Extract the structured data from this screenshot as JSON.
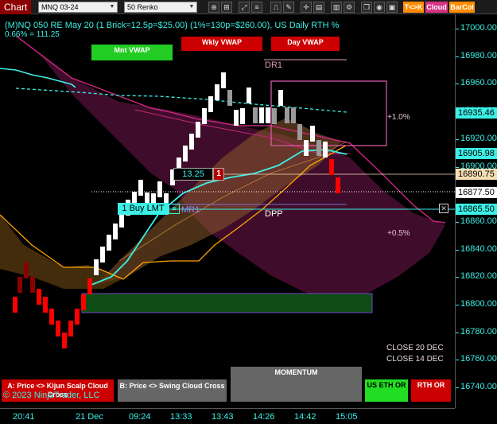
{
  "toolbar": {
    "app_label": "Chart",
    "instrument": "MNQ 03-24",
    "bar_type": "50 Renko",
    "tk_label": "T<>K",
    "cloud_label": "Cloud",
    "barcol_label": "BarCol"
  },
  "chart": {
    "title": "(M)NQ 050 RE May 20 (1 Brick=12.5p=$25.00) (1%=130p=$260.00), US Daily RTH %",
    "subtitle": "0.66% = 111.25",
    "mnt_vwap_label": "Mnt VWAP",
    "wkly_vwap_label": "Wkly VWAP",
    "day_vwap_label": "Day VWAP",
    "dr1_label": "DR1",
    "mr1_label": "MR1",
    "dpp_label": "DPP",
    "pct_up_label": "+1.0%",
    "pct_down_label": "+0.5%",
    "order_qty_value": "13.25",
    "order_badge": "1",
    "buy_lmt_label": "1 Buy LMT",
    "close_20": "CLOSE 20 DEC",
    "close_14": "CLOSE 14 DEC",
    "copyright": "© 2023 NinjaTrader, LLC"
  },
  "price_axis": {
    "ticks": [
      "17000.00",
      "16980.00",
      "16960.00",
      "16940.00",
      "16920.00",
      "16900.00",
      "16880.00",
      "16860.00",
      "16840.00",
      "16820.00",
      "16800.00",
      "16780.00",
      "16760.00",
      "16740.00"
    ],
    "tags": [
      {
        "label": "16935.46",
        "bg": "#3cf0e6",
        "fg": "#000000"
      },
      {
        "label": "16905.98",
        "bg": "#3cf0e6",
        "fg": "#000000"
      },
      {
        "label": "16890.75",
        "bg": "#f5deb3",
        "fg": "#000000"
      },
      {
        "label": "16877.50",
        "bg": "#ffffff",
        "fg": "#000000"
      },
      {
        "label": "16865.50",
        "bg": "#3cf0e6",
        "fg": "#000000"
      }
    ]
  },
  "time_axis": {
    "ticks": [
      "20:41",
      "21 Dec",
      "09:24",
      "13:33",
      "13:43",
      "14:26",
      "14:42",
      "15:05"
    ]
  },
  "bottom_buttons": {
    "kijun_cross": "A: Price <> Kijun Scalp Cloud Cross",
    "swing_cross": "B: Price <> Swing Cloud Cross",
    "momentum": "MOMENTUM",
    "us_eth": "US ETH OR",
    "rth": "RTH OR"
  },
  "colors": {
    "accent": "#3cf0e6",
    "bull_brick": "#ffffff",
    "bear_brick": "#ff0000",
    "green_button": "#22dd22",
    "red_button": "#cc0000"
  }
}
